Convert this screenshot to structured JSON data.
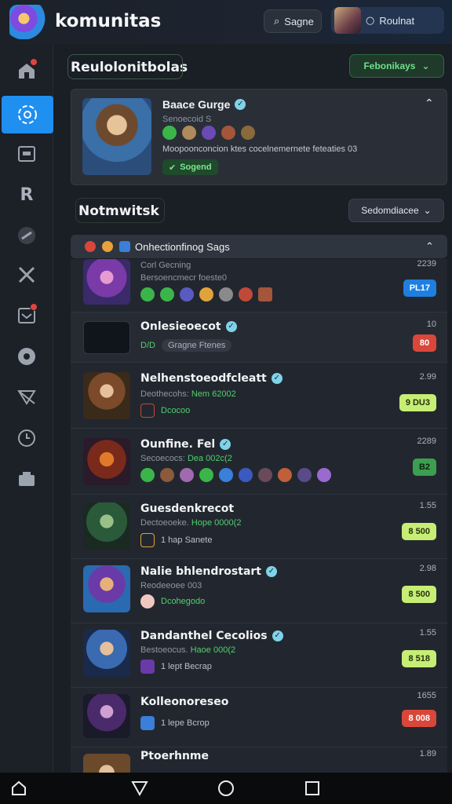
{
  "header": {
    "title": "komunitas",
    "search_label": "Sagne",
    "account_label": "Roulnat"
  },
  "rail": {
    "items": [
      {
        "name": "home",
        "icon": "home-icon",
        "badge": true
      },
      {
        "name": "community",
        "icon": "community-icon",
        "active": true
      },
      {
        "name": "media",
        "icon": "media-icon"
      },
      {
        "name": "replay",
        "icon": "r-icon"
      },
      {
        "name": "explore",
        "icon": "compass-icon"
      },
      {
        "name": "battle",
        "icon": "swords-icon"
      },
      {
        "name": "inbox",
        "icon": "inbox-icon",
        "badge": true
      },
      {
        "name": "chat",
        "icon": "chat-icon"
      },
      {
        "name": "send",
        "icon": "send-icon"
      },
      {
        "name": "history",
        "icon": "clock-icon"
      },
      {
        "name": "wallet",
        "icon": "wallet-icon"
      }
    ]
  },
  "section1": {
    "title": "Reulolonitbolas",
    "filter_label": "Febonikays"
  },
  "featured": {
    "title": "Baace Gurge",
    "subtitle": "Senoecoid S",
    "description": "Moopoonconcion ktes cocelnemernete feteaties 03",
    "tag_label": "Sogend"
  },
  "section2": {
    "title": "Notmwitsk",
    "sort_label": "Sedomdiacee"
  },
  "group": {
    "label": "Onhectionfinog Sags"
  },
  "rows": [
    {
      "title": "",
      "subtitle": "Corl Gecning",
      "sub2": "Bersoencmecr foeste0",
      "num": "2239",
      "badge": "PL17",
      "badge_type": "blue"
    },
    {
      "title": "Onlesieoecot",
      "subtitle": "D/D",
      "tag": "Gragne Ftenes",
      "num": "10",
      "badge": "80",
      "badge_type": "red"
    },
    {
      "title": "Nelhenstoeodfcleatt",
      "subtitle": "Deothecohs:",
      "sub_hl": "Nem 62002",
      "tagline": "Dcocoo",
      "num": "2.99",
      "badge": "9 DU3",
      "badge_type": "lime"
    },
    {
      "title": "Ounfine. Fel",
      "subtitle": "Secoecocs:",
      "sub_hl": "Dea 002c(2",
      "num": "2289",
      "badge": "B2",
      "badge_type": "green"
    },
    {
      "title": "Guesdenkrecot",
      "subtitle": "Dectoeoeke.",
      "sub_hl": "Hope 0000(2",
      "tagline": "1 hap Sanete",
      "num": "1.55",
      "badge": "8 500",
      "badge_type": "lime"
    },
    {
      "title": "Nalie bhlendrostart",
      "subtitle": "Reodeeoee 003",
      "tagline": "Dcohegodo",
      "num": "2.98",
      "badge": "8 500",
      "badge_type": "lime"
    },
    {
      "title": "Dandanthel Cecolios",
      "subtitle": "Bestoeocus.",
      "sub_hl": "Haoe 000(2",
      "tagline": "1 lept Becrap",
      "num": "1.55",
      "badge": "8 518",
      "badge_type": "lime"
    },
    {
      "title": "Kolleonoreseo",
      "subtitle": "",
      "tagline": "1 lepe Bcrop",
      "num": "1655",
      "badge": "8 008",
      "badge_type": "red"
    },
    {
      "title": "Ptoerhnme",
      "subtitle": "",
      "num": "1.89",
      "badge": "",
      "badge_type": "lime"
    }
  ]
}
